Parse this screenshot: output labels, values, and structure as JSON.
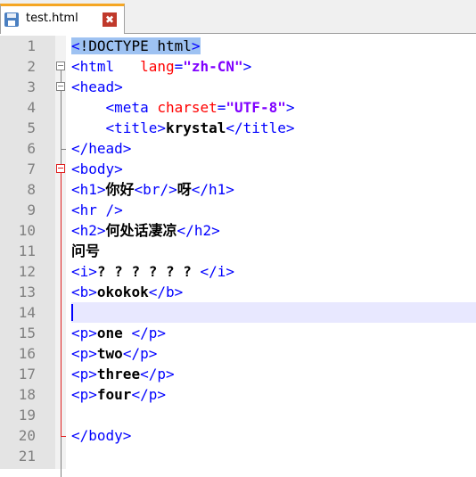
{
  "tab": {
    "filename": "test.html",
    "close_glyph": "✖",
    "save_icon": "save-icon"
  },
  "editor": {
    "lines": [
      {
        "n": "1",
        "tokens": [
          {
            "c": "hl-tag",
            "t": "<"
          },
          {
            "c": "hl",
            "t": "!DOCTYPE html"
          },
          {
            "c": "hl-tag",
            "t": ">"
          }
        ]
      },
      {
        "n": "2",
        "tokens": [
          {
            "c": "tag",
            "t": "<html   "
          },
          {
            "c": "attr",
            "t": "lang"
          },
          {
            "c": "tag",
            "t": "="
          },
          {
            "c": "val",
            "t": "\"zh-CN\""
          },
          {
            "c": "tag",
            "t": ">"
          }
        ]
      },
      {
        "n": "3",
        "tokens": [
          {
            "c": "tag",
            "t": "<head>"
          }
        ]
      },
      {
        "n": "4",
        "tokens": [
          {
            "c": "tag",
            "t": "    <meta "
          },
          {
            "c": "attr",
            "t": "charset"
          },
          {
            "c": "tag",
            "t": "="
          },
          {
            "c": "val",
            "t": "\"UTF-8\""
          },
          {
            "c": "tag",
            "t": ">"
          }
        ]
      },
      {
        "n": "5",
        "tokens": [
          {
            "c": "tag",
            "t": "    <title>"
          },
          {
            "c": "text",
            "t": "krystal"
          },
          {
            "c": "tag",
            "t": "</title>"
          }
        ]
      },
      {
        "n": "6",
        "tokens": [
          {
            "c": "tag",
            "t": "</head>"
          }
        ]
      },
      {
        "n": "7",
        "tokens": [
          {
            "c": "tag",
            "t": "<body>"
          }
        ]
      },
      {
        "n": "8",
        "tokens": [
          {
            "c": "tag",
            "t": "<h1>"
          },
          {
            "c": "text",
            "t": "你好"
          },
          {
            "c": "tag",
            "t": "<br/>"
          },
          {
            "c": "text",
            "t": "呀"
          },
          {
            "c": "tag",
            "t": "</h1>"
          }
        ]
      },
      {
        "n": "9",
        "tokens": [
          {
            "c": "tag",
            "t": "<hr />"
          }
        ]
      },
      {
        "n": "10",
        "tokens": [
          {
            "c": "tag",
            "t": "<h2>"
          },
          {
            "c": "text",
            "t": "何处话凄凉"
          },
          {
            "c": "tag",
            "t": "</h2>"
          }
        ]
      },
      {
        "n": "11",
        "tokens": [
          {
            "c": "text",
            "t": "问号"
          }
        ]
      },
      {
        "n": "12",
        "tokens": [
          {
            "c": "tag",
            "t": "<i>"
          },
          {
            "c": "text",
            "t": "? ? ? ? ? ? "
          },
          {
            "c": "tag",
            "t": "</i>"
          }
        ]
      },
      {
        "n": "13",
        "tokens": [
          {
            "c": "tag",
            "t": "<b>"
          },
          {
            "c": "text",
            "t": "okokok"
          },
          {
            "c": "tag",
            "t": "</b>"
          }
        ]
      },
      {
        "n": "14",
        "tokens": []
      },
      {
        "n": "15",
        "tokens": [
          {
            "c": "tag",
            "t": "<p>"
          },
          {
            "c": "text",
            "t": "one "
          },
          {
            "c": "tag",
            "t": "</p>"
          }
        ]
      },
      {
        "n": "16",
        "tokens": [
          {
            "c": "tag",
            "t": "<p>"
          },
          {
            "c": "text",
            "t": "two"
          },
          {
            "c": "tag",
            "t": "</p>"
          }
        ]
      },
      {
        "n": "17",
        "tokens": [
          {
            "c": "tag",
            "t": "<p>"
          },
          {
            "c": "text",
            "t": "three"
          },
          {
            "c": "tag",
            "t": "</p>"
          }
        ]
      },
      {
        "n": "18",
        "tokens": [
          {
            "c": "tag",
            "t": "<p>"
          },
          {
            "c": "text",
            "t": "four"
          },
          {
            "c": "tag",
            "t": "</p>"
          }
        ]
      },
      {
        "n": "19",
        "tokens": []
      },
      {
        "n": "20",
        "tokens": [
          {
            "c": "tag",
            "t": "</body>"
          }
        ]
      },
      {
        "n": "21",
        "tokens": []
      }
    ],
    "current_line": "14"
  },
  "colors": {
    "tag": "#0000ff",
    "attribute": "#ff0000",
    "value": "#8000ff",
    "text": "#000000",
    "current_line_bg": "#e8e8ff",
    "tab_accent": "#f5a623"
  }
}
